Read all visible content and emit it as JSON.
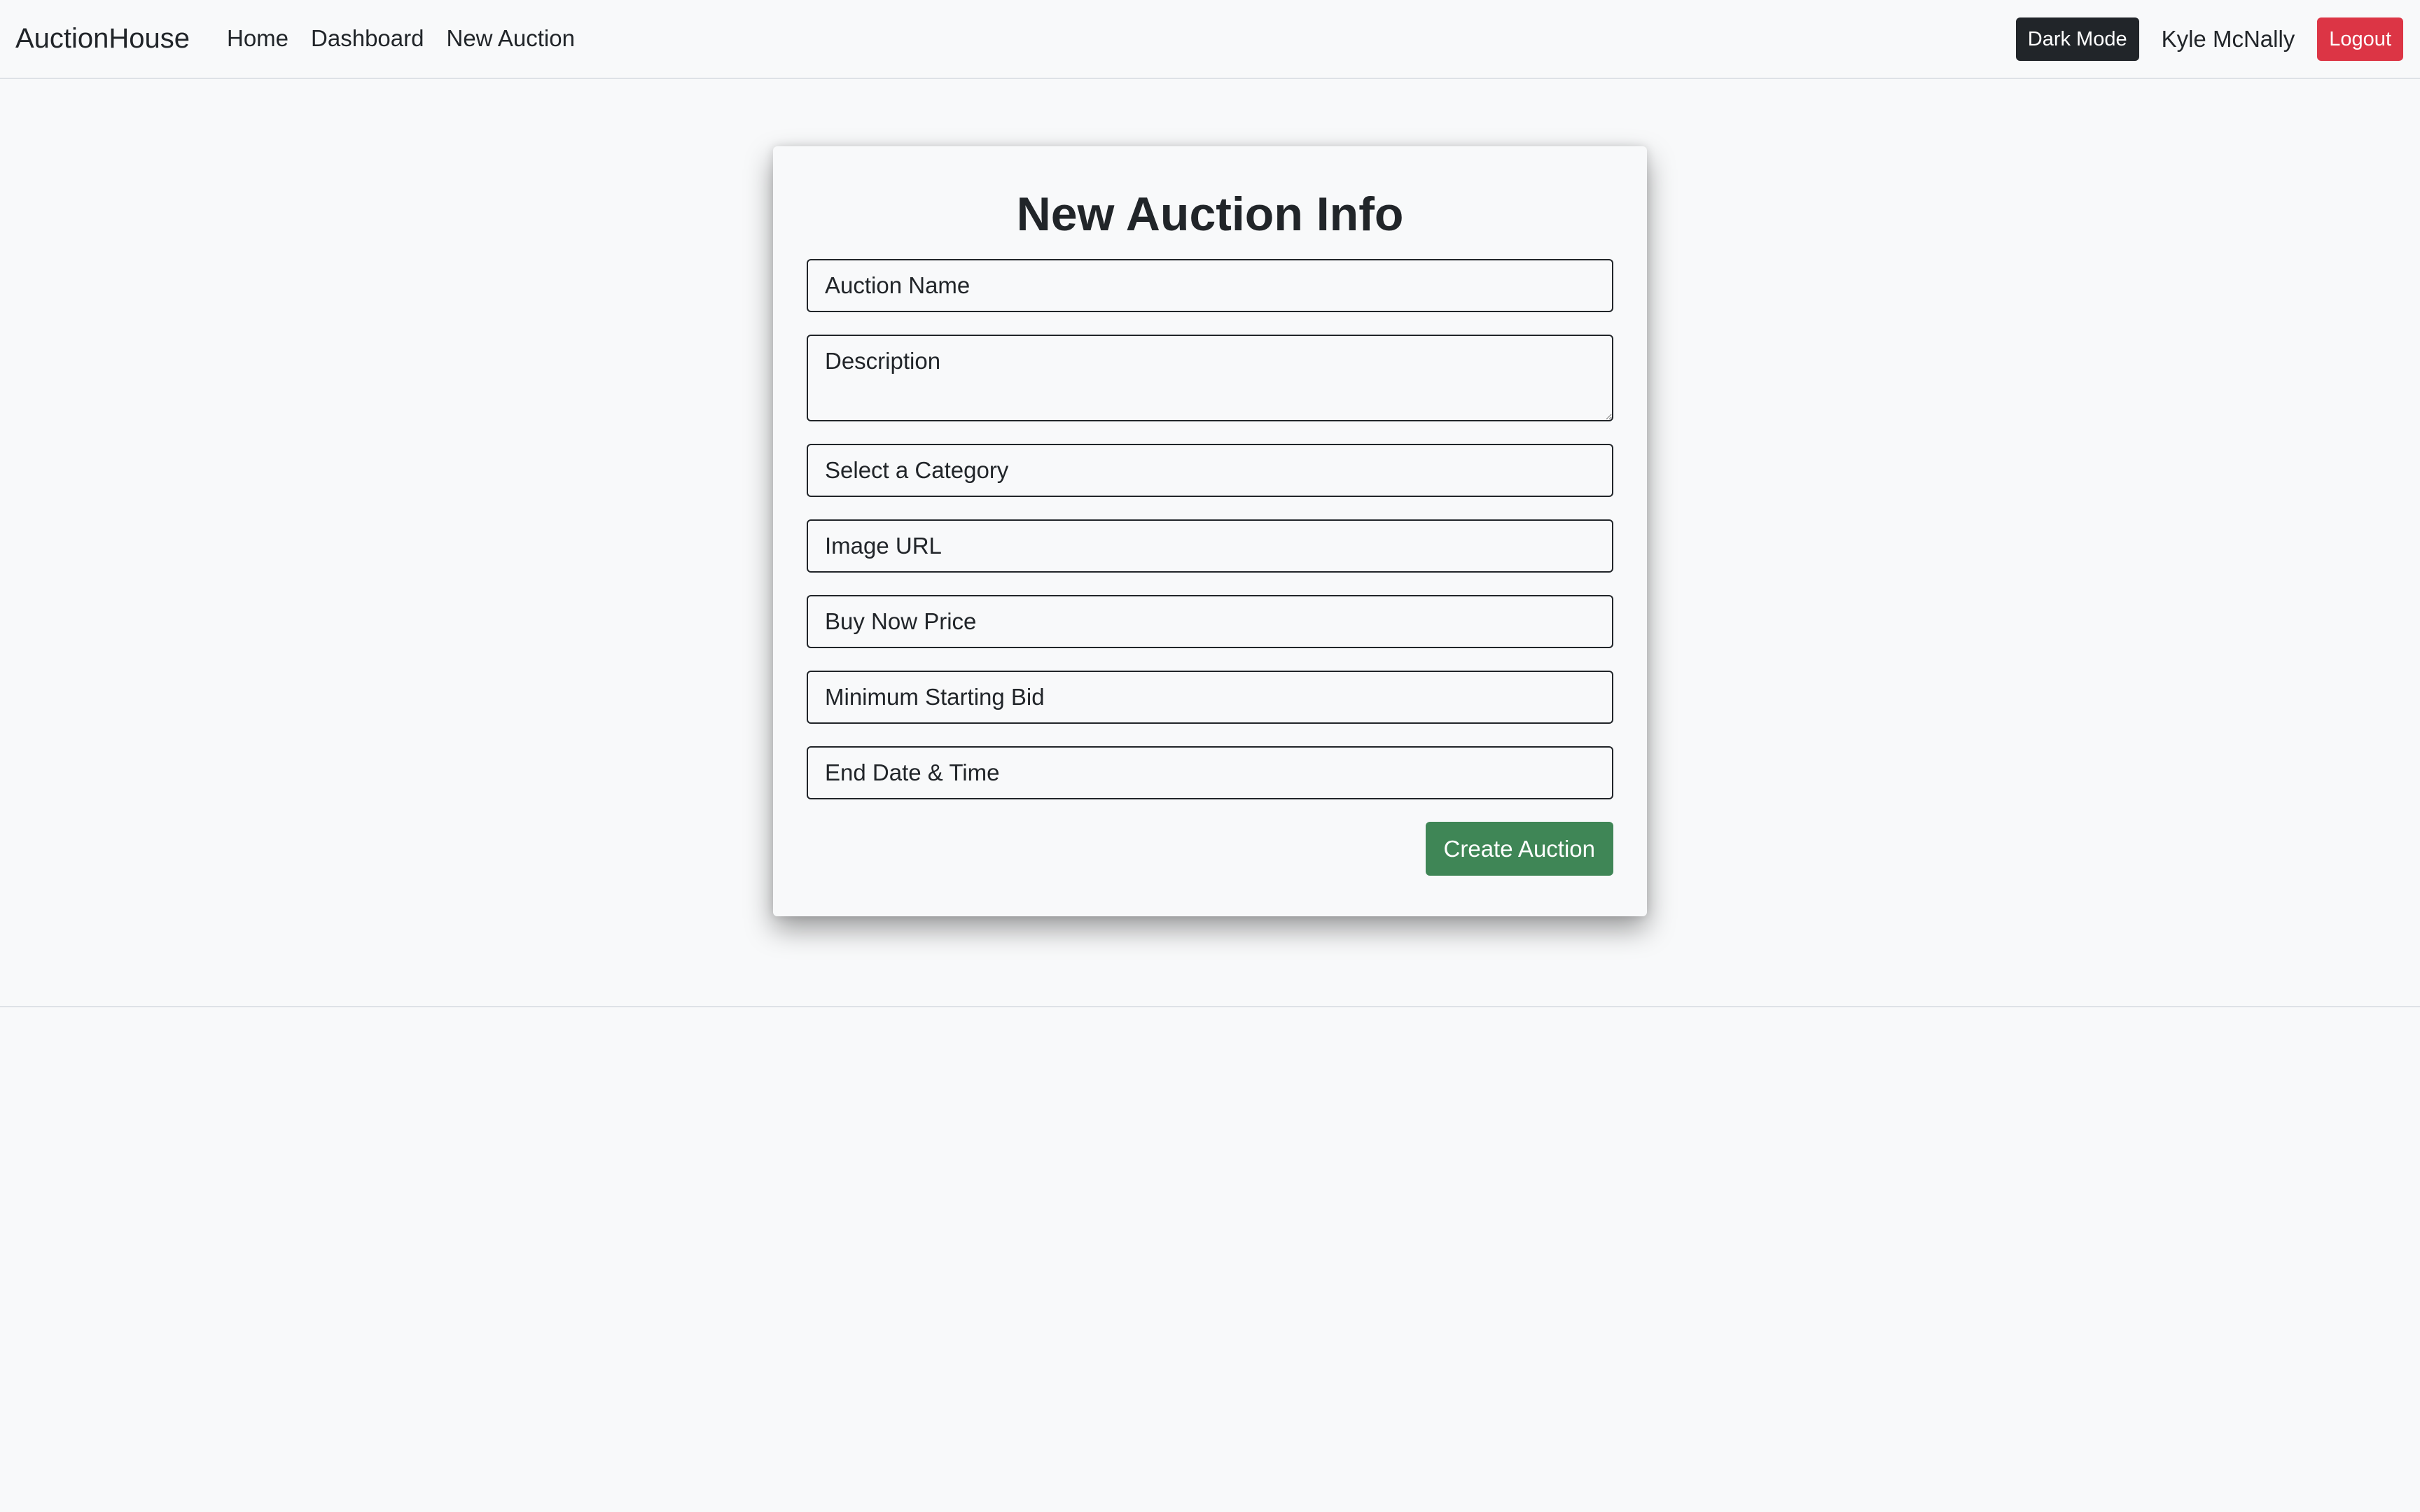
{
  "navbar": {
    "brand": "AuctionHouse",
    "links": [
      "Home",
      "Dashboard",
      "New Auction"
    ],
    "dark_mode_label": "Dark Mode",
    "user_name": "Kyle McNally",
    "logout_label": "Logout"
  },
  "form": {
    "title": "New Auction Info",
    "fields": {
      "auction_name": {
        "placeholder": "Auction Name",
        "value": ""
      },
      "description": {
        "placeholder": "Description",
        "value": ""
      },
      "category": {
        "selected": "Select a Category"
      },
      "image_url": {
        "placeholder": "Image URL",
        "value": ""
      },
      "buy_now_price": {
        "placeholder": "Buy Now Price",
        "value": ""
      },
      "min_starting_bid": {
        "placeholder": "Minimum Starting Bid",
        "value": ""
      },
      "end_datetime": {
        "placeholder": "End Date & Time",
        "value": ""
      }
    },
    "submit_label": "Create Auction"
  },
  "colors": {
    "background": "#f8f9fa",
    "text": "#212529",
    "dark_button": "#212529",
    "danger_button": "#dc3545",
    "success_button": "#3f8656",
    "border": "#dee2e6"
  }
}
